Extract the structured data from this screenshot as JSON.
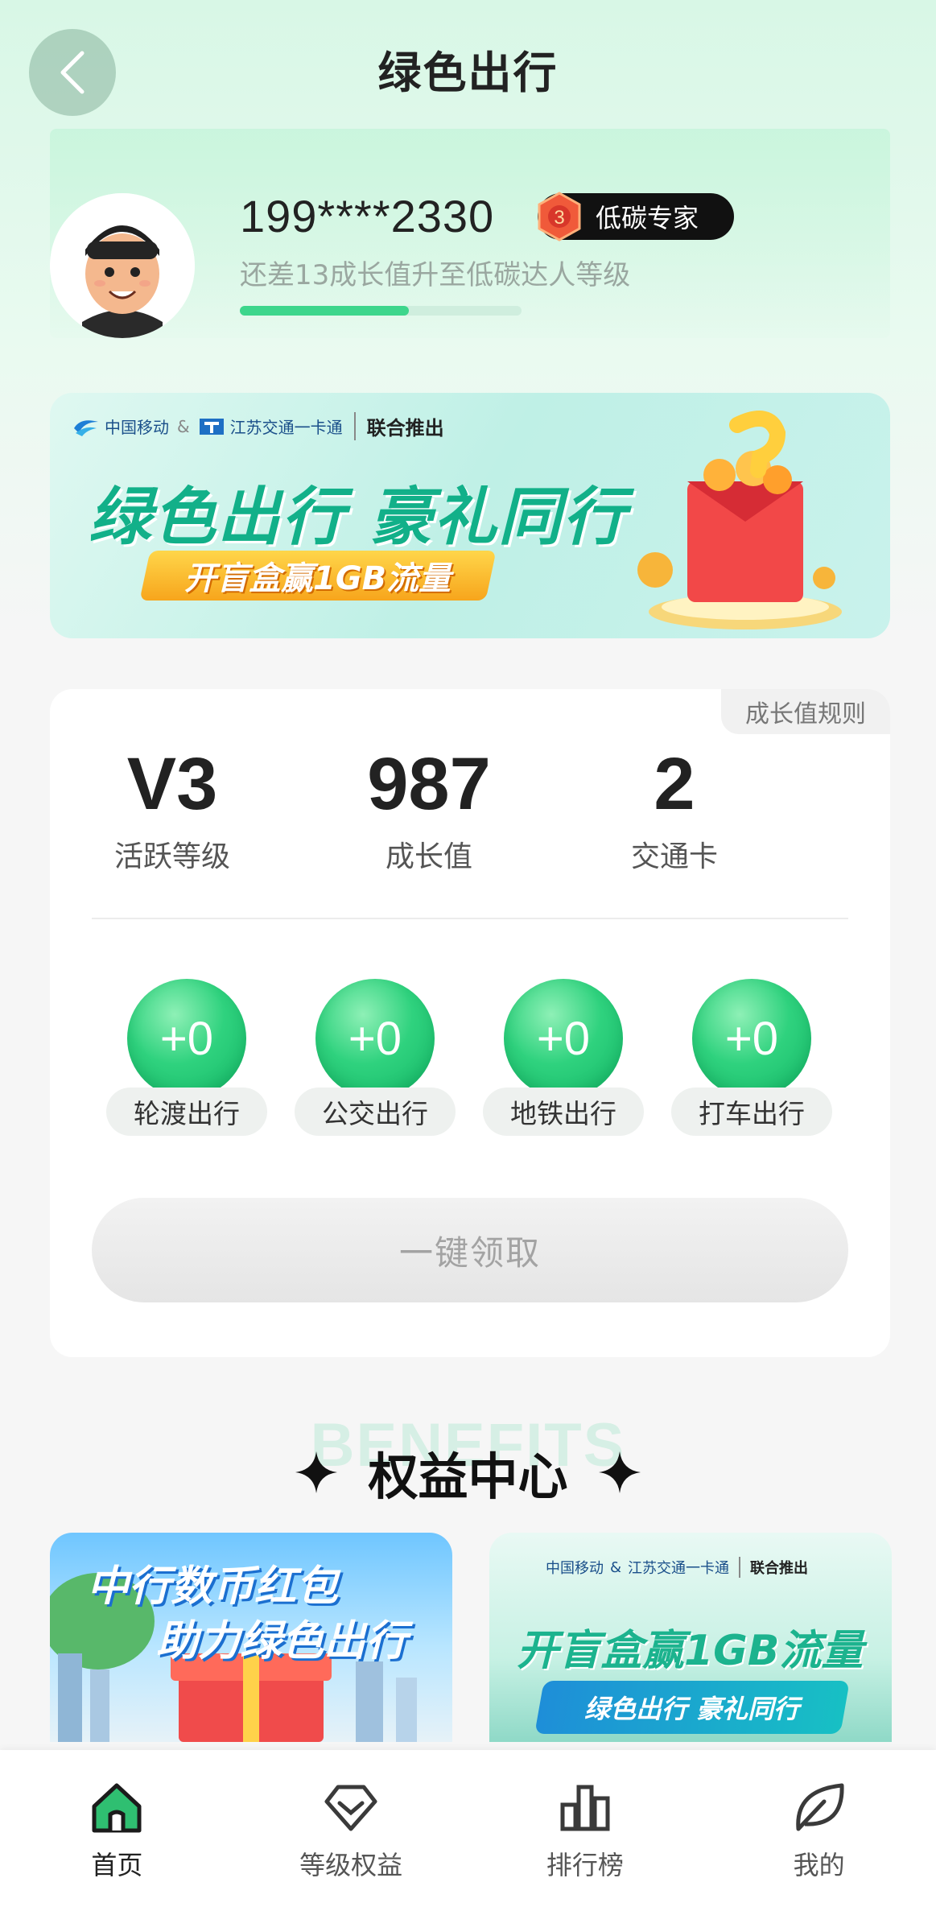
{
  "header": {
    "title": "绿色出行"
  },
  "profile": {
    "phone": "199****2330",
    "badge": {
      "level_number": "3",
      "title": "低碳专家"
    },
    "progress_hint": "还差13成长值升至低碳达人等级",
    "progress_fraction": 0.6
  },
  "banner": {
    "partner_1": "中国移动",
    "partner_1_en": "China Mobile",
    "partner_2": "江苏交通一卡通",
    "partner_2_en": "JIANGSU T-UNION",
    "joint": "联合推出",
    "headline": "绿色出行 豪礼同行",
    "cta": "开盲盒赢1GB流量"
  },
  "stats": {
    "rules_label": "成长值规则",
    "items": [
      {
        "value": "V3",
        "label": "活跃等级"
      },
      {
        "value": "987",
        "label": "成长值"
      },
      {
        "value": "2",
        "label": "交通卡"
      }
    ]
  },
  "travel": {
    "items": [
      {
        "points": "+0",
        "label": "轮渡出行"
      },
      {
        "points": "+0",
        "label": "公交出行"
      },
      {
        "points": "+0",
        "label": "地铁出行"
      },
      {
        "points": "+0",
        "label": "打车出行"
      }
    ],
    "claim_label": "一键领取"
  },
  "benefits": {
    "bg_text": "BENEFITS",
    "title": "权益中心",
    "promo_left": {
      "line1": "中行数币红包",
      "line2": "助力绿色出行"
    },
    "promo_right": {
      "partner_1": "中国移动",
      "partner_2": "江苏交通一卡通",
      "joint": "联合推出",
      "headline": "开盲盒赢1GB流量",
      "sub": "绿色出行 豪礼同行"
    }
  },
  "tabbar": {
    "items": [
      {
        "label": "首页",
        "icon": "home-icon"
      },
      {
        "label": "等级权益",
        "icon": "diamond-icon"
      },
      {
        "label": "排行榜",
        "icon": "bar-chart-icon"
      },
      {
        "label": "我的",
        "icon": "leaf-icon"
      }
    ],
    "active_color": "#2fbf71"
  }
}
